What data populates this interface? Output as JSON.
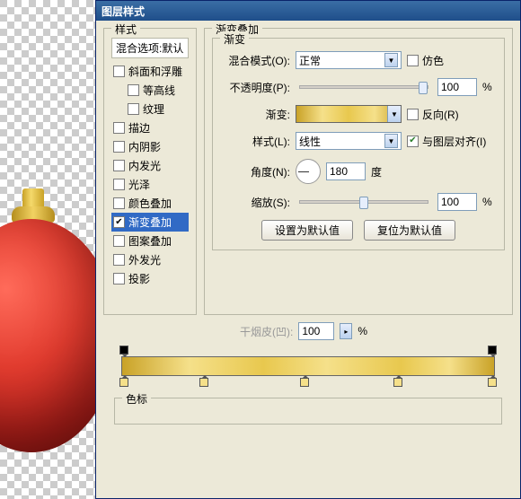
{
  "dialog": {
    "title": "图层样式"
  },
  "styles": {
    "group_label": "样式",
    "header": "混合选项:默认",
    "items": [
      {
        "label": "斜面和浮雕",
        "checked": false
      },
      {
        "label": "等高线",
        "checked": false,
        "indent": true
      },
      {
        "label": "纹理",
        "checked": false,
        "indent": true
      },
      {
        "label": "描边",
        "checked": false
      },
      {
        "label": "内阴影",
        "checked": false
      },
      {
        "label": "内发光",
        "checked": false
      },
      {
        "label": "光泽",
        "checked": false
      },
      {
        "label": "颜色叠加",
        "checked": false
      },
      {
        "label": "渐变叠加",
        "checked": true,
        "selected": true
      },
      {
        "label": "图案叠加",
        "checked": false
      },
      {
        "label": "外发光",
        "checked": false
      },
      {
        "label": "投影",
        "checked": false
      }
    ]
  },
  "gradient_overlay": {
    "group_label": "渐变叠加",
    "inner_label": "渐变",
    "blend_mode": {
      "label": "混合模式(O):",
      "value": "正常"
    },
    "dither": {
      "label": "仿色",
      "checked": false
    },
    "opacity": {
      "label": "不透明度(P):",
      "value": "100",
      "unit": "%"
    },
    "gradient": {
      "label": "渐变:"
    },
    "reverse": {
      "label": "反向(R)",
      "checked": false
    },
    "style": {
      "label": "样式(L):",
      "value": "线性"
    },
    "align": {
      "label": "与图层对齐(I)",
      "checked": true
    },
    "angle": {
      "label": "角度(N):",
      "value": "180",
      "unit": "度"
    },
    "scale": {
      "label": "缩放(S):",
      "value": "100",
      "unit": "%"
    },
    "btn_default": "设置为默认值",
    "btn_reset": "复位为默认值"
  },
  "editor": {
    "cut_label": "干烟皮(凹):",
    "cut_value": "100",
    "cut_unit": "%",
    "colorstop_label": "色标"
  }
}
